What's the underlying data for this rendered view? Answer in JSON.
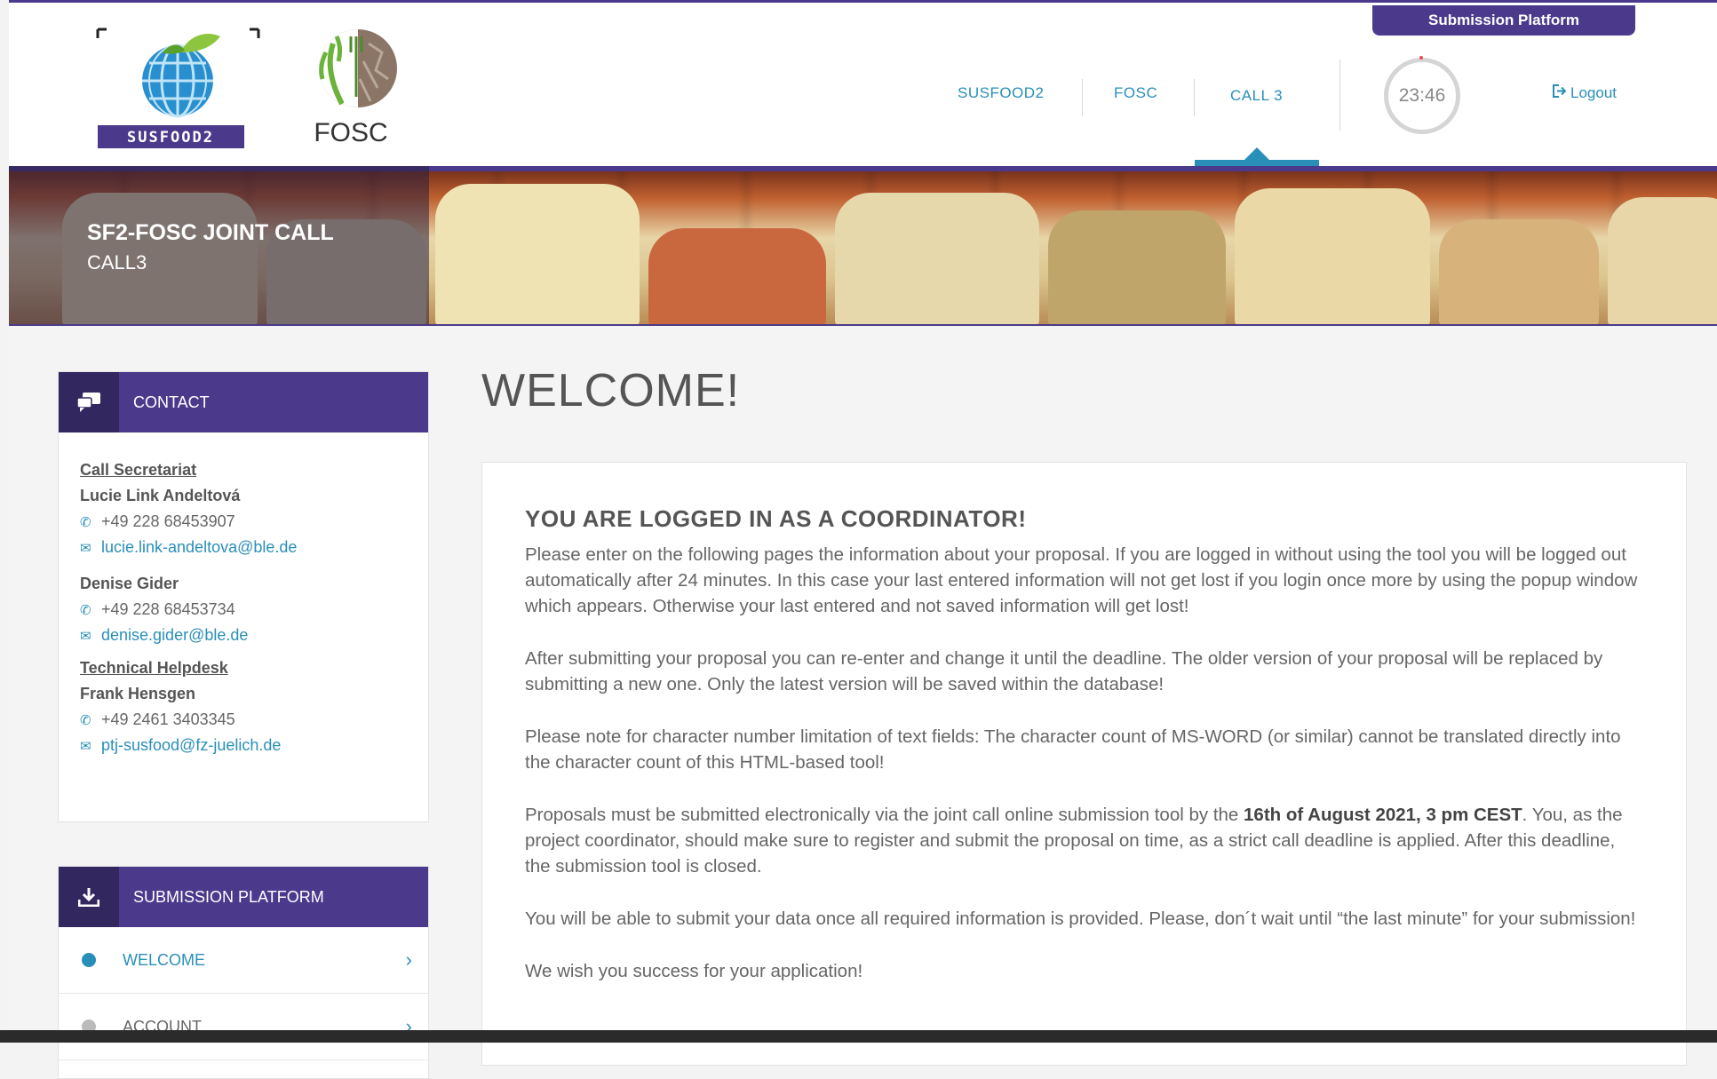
{
  "header": {
    "submission_platform_tab": "Submission Platform",
    "logo1_text": "SUSFOOD2",
    "logo2_text": "FOSC",
    "nav": [
      "SUSFOOD2",
      "FOSC",
      "CALL 3"
    ],
    "timer": "23:46",
    "logout": "Logout"
  },
  "banner": {
    "title": "SF2-FOSC JOINT CALL",
    "subtitle": "CALL3"
  },
  "sidebar": {
    "contact": {
      "heading": "CONTACT",
      "sections": [
        {
          "title": "Call Secretariat",
          "name": "Lucie Link Andeltová",
          "phone": "+49 228 68453907",
          "email": "lucie.link-andeltova@ble.de"
        },
        {
          "title": "",
          "name": "Denise Gider",
          "phone": "+49 228 68453734",
          "email": "denise.gider@ble.de"
        },
        {
          "title": "Technical Helpdesk",
          "name": "Frank Hensgen",
          "phone": "+49 2461 3403345",
          "email": "ptj-susfood@fz-juelich.de"
        }
      ]
    },
    "submission": {
      "heading": "SUBMISSION PLATFORM",
      "items": [
        "WELCOME",
        "ACCOUNT"
      ]
    }
  },
  "main": {
    "title": "WELCOME!",
    "heading": "YOU ARE LOGGED IN AS A COORDINATOR!",
    "p1": "Please enter on the following pages the information about your proposal. If you are logged in without using the tool you will be logged out automatically after 24 minutes. In this case your last entered information will not get lost if you login once more by using the popup window which appears. Otherwise your last entered and not saved information will get lost!",
    "p2": "After submitting your proposal you can re-enter and change it until the deadline. The older version of your proposal will be replaced by submitting a new one. Only the latest version will be saved within the database!",
    "p3": "Please note for character number limitation of text fields: The character count of MS-WORD (or similar) cannot be translated directly into the character count of this HTML-based tool!",
    "p4_a": "Proposals must be submitted electronically via the joint call online submission tool by the ",
    "p4_bold": "16th of August 2021, 3 pm CEST",
    "p4_b": ". You, as the project coordinator, should make sure to register and submit the proposal on time, as a strict call deadline is applied. After this deadline, the submission tool is closed.",
    "p5": "You will be able to submit your data once all required information is provided. Please, don´t wait until “the last minute” for your submission!",
    "p6": "We wish you success for your application!"
  }
}
